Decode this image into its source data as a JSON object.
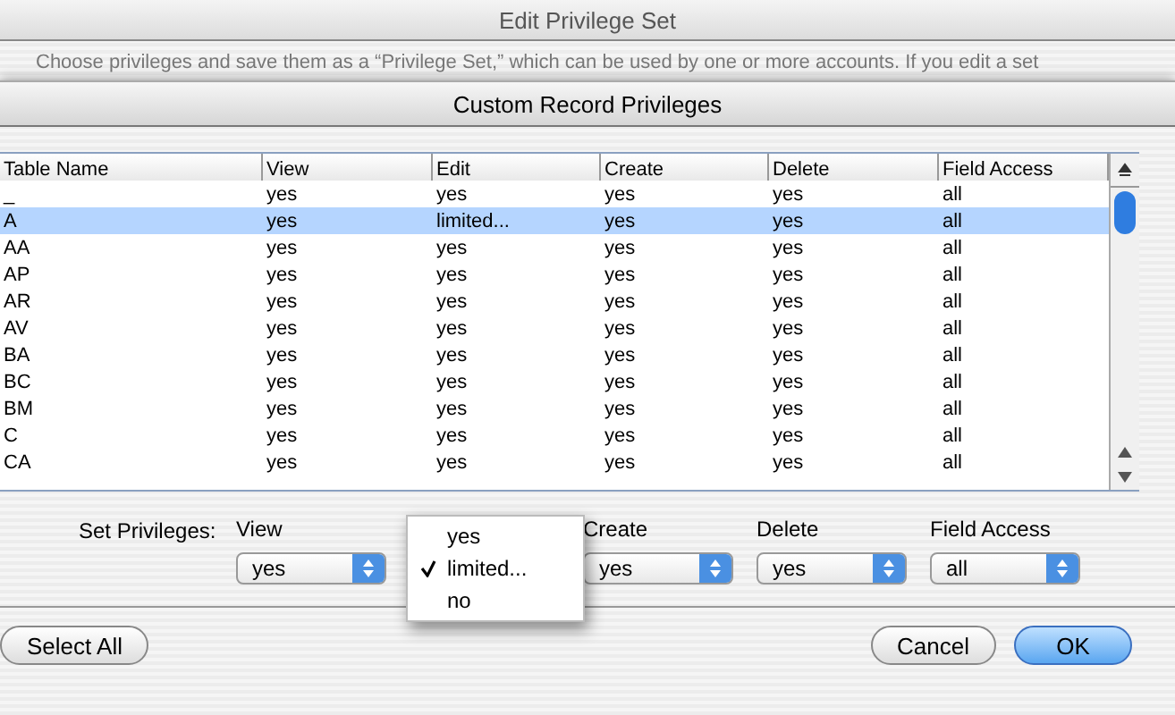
{
  "window": {
    "title": "Edit Privilege Set",
    "description": "Choose privileges and save them as a “Privilege Set,” which can be used by one or more accounts. If you edit a set"
  },
  "sheet": {
    "title": "Custom Record Privileges"
  },
  "table": {
    "columns": [
      "Table Name",
      "View",
      "Edit",
      "Create",
      "Delete",
      "Field Access"
    ],
    "rows": [
      {
        "cells": [
          "_",
          "yes",
          "yes",
          "yes",
          "yes",
          "all"
        ],
        "selected": false
      },
      {
        "cells": [
          "A",
          "yes",
          "limited...",
          "yes",
          "yes",
          "all"
        ],
        "selected": true
      },
      {
        "cells": [
          "AA",
          "yes",
          "yes",
          "yes",
          "yes",
          "all"
        ],
        "selected": false
      },
      {
        "cells": [
          "AP",
          "yes",
          "yes",
          "yes",
          "yes",
          "all"
        ],
        "selected": false
      },
      {
        "cells": [
          "AR",
          "yes",
          "yes",
          "yes",
          "yes",
          "all"
        ],
        "selected": false
      },
      {
        "cells": [
          "AV",
          "yes",
          "yes",
          "yes",
          "yes",
          "all"
        ],
        "selected": false
      },
      {
        "cells": [
          "BA",
          "yes",
          "yes",
          "yes",
          "yes",
          "all"
        ],
        "selected": false
      },
      {
        "cells": [
          "BC",
          "yes",
          "yes",
          "yes",
          "yes",
          "all"
        ],
        "selected": false
      },
      {
        "cells": [
          "BM",
          "yes",
          "yes",
          "yes",
          "yes",
          "all"
        ],
        "selected": false
      },
      {
        "cells": [
          "C",
          "yes",
          "yes",
          "yes",
          "yes",
          "all"
        ],
        "selected": false
      },
      {
        "cells": [
          "CA",
          "yes",
          "yes",
          "yes",
          "yes",
          "all"
        ],
        "selected": false
      }
    ]
  },
  "set_privileges": {
    "label": "Set Privileges:",
    "fields": [
      {
        "kind": "popup",
        "label": "View",
        "value": "yes"
      },
      {
        "kind": "open",
        "options": [
          {
            "label": "yes",
            "selected": false
          },
          {
            "label": "limited...",
            "selected": true
          },
          {
            "label": "no",
            "selected": false
          }
        ]
      },
      {
        "kind": "popup",
        "label": "Create",
        "value": "yes"
      },
      {
        "kind": "popup",
        "label": "Delete",
        "value": "yes"
      },
      {
        "kind": "popup",
        "label": "Field Access",
        "value": "all"
      }
    ]
  },
  "buttons": [
    {
      "label": "Select All",
      "default": false
    },
    {
      "label": "Cancel",
      "default": false
    },
    {
      "label": "OK",
      "default": true
    }
  ]
}
